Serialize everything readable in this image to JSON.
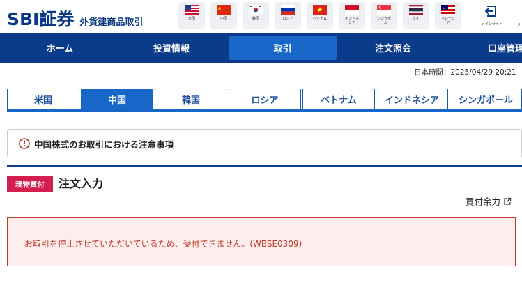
{
  "header": {
    "logo_main": "SBI証券",
    "logo_sub": "外貨建商品取引",
    "flags": [
      {
        "label": "米国",
        "icon": "us-flag-icon"
      },
      {
        "label": "中国",
        "icon": "cn-flag-icon"
      },
      {
        "label": "韓国",
        "icon": "kr-flag-icon"
      },
      {
        "label": "ロシア",
        "icon": "ru-flag-icon"
      },
      {
        "label": "ベトナム",
        "icon": "vn-flag-icon"
      },
      {
        "label": "インドネ\nシア",
        "icon": "id-flag-icon"
      },
      {
        "label": "シンガポ\nール",
        "icon": "sg-flag-icon"
      },
      {
        "label": "タイ",
        "icon": "th-flag-icon"
      },
      {
        "label": "マレーシ\nア",
        "icon": "my-flag-icon"
      }
    ],
    "logout_label": "メインサイト",
    "edge_label": "メ"
  },
  "nav": {
    "items": [
      "ホーム",
      "投資情報",
      "取引",
      "注文照会",
      "口座管理"
    ],
    "active": "取引"
  },
  "datetime": "日本時間：2025/04/29 20:21",
  "country_tabs": {
    "items": [
      "米国",
      "中国",
      "韓国",
      "ロシア",
      "ベトナム",
      "インドネシア",
      "シンガポール"
    ],
    "active": "中国"
  },
  "notice": {
    "text": "中国株式のお取引における注意事項",
    "icon": "info-circle-icon"
  },
  "order": {
    "badge": "現物買付",
    "title": "注文入力",
    "buying_power": "買付余力"
  },
  "error": {
    "message": "お取引を停止させていただいているため、受付できません。(WBSE0309)"
  },
  "colors": {
    "brand_navy": "#0b3c8c",
    "accent_blue": "#1766c8",
    "badge_red": "#d41e4e",
    "error_red": "#c0392b",
    "error_bg": "#fdeeee"
  }
}
